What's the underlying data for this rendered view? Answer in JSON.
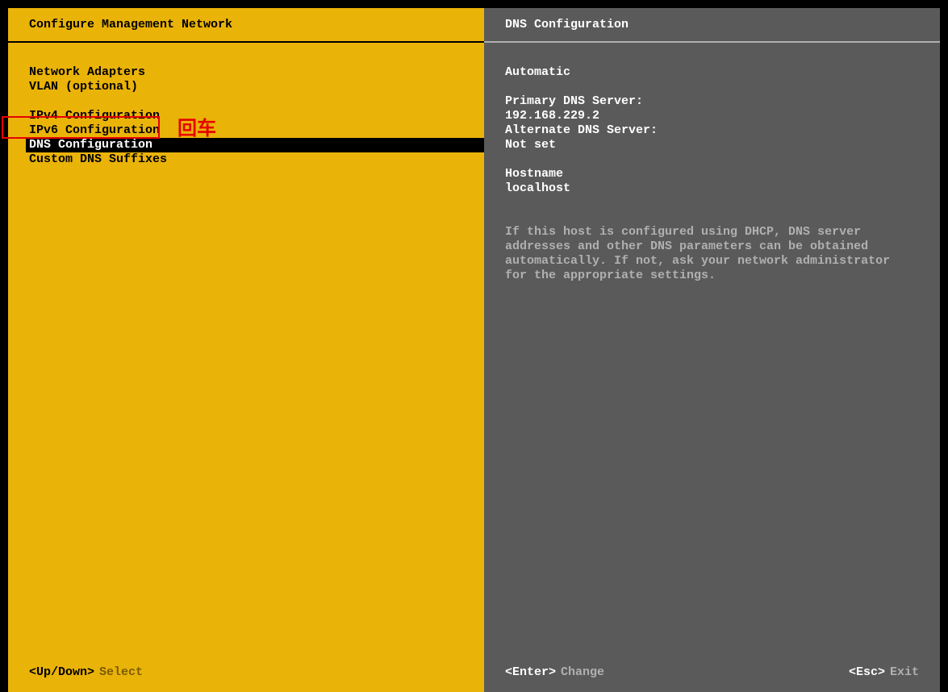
{
  "left": {
    "title": "Configure Management Network",
    "menu": [
      {
        "label": "Network Adapters",
        "selected": false
      },
      {
        "label": "VLAN (optional)",
        "selected": false
      },
      {
        "label": "",
        "selected": false,
        "spacer": true
      },
      {
        "label": "IPv4 Configuration",
        "selected": false
      },
      {
        "label": "IPv6 Configuration",
        "selected": false
      },
      {
        "label": "DNS Configuration",
        "selected": true
      },
      {
        "label": "Custom DNS Suffixes",
        "selected": false
      }
    ],
    "footer": {
      "key": "<Up/Down>",
      "action": "Select"
    }
  },
  "right": {
    "title": "DNS Configuration",
    "lines": {
      "mode": "Automatic",
      "primary_label": "Primary DNS Server:",
      "primary_value": "192.168.229.2",
      "alternate_label": "Alternate DNS Server:",
      "alternate_value": "Not set",
      "hostname_label": "Hostname",
      "hostname_value": "localhost"
    },
    "help": "If this host is configured using DHCP, DNS server addresses and other DNS parameters can be obtained automatically. If not, ask your network administrator for the appropriate settings.",
    "footer": {
      "enter_key": "<Enter>",
      "enter_action": "Change",
      "esc_key": "<Esc>",
      "esc_action": "Exit"
    }
  },
  "annotation": {
    "text": "回车"
  }
}
